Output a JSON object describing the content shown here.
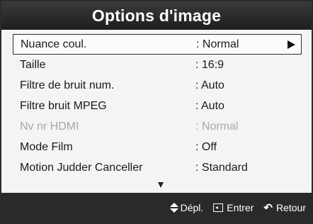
{
  "title": "Options d'image",
  "menu": {
    "items": [
      {
        "label": "Nuance coul.",
        "value": ": Normal",
        "state": "selected"
      },
      {
        "label": "Taille",
        "value": ": 16:9",
        "state": "normal"
      },
      {
        "label": "Filtre de bruit num.",
        "value": ": Auto",
        "state": "normal"
      },
      {
        "label": "Filtre bruit MPEG",
        "value": ": Auto",
        "state": "normal"
      },
      {
        "label": "Nv nr HDMI",
        "value": ": Normal",
        "state": "disabled"
      },
      {
        "label": "Mode Film",
        "value": ": Off",
        "state": "normal"
      },
      {
        "label": "Motion Judder Canceller",
        "value": ": Standard",
        "state": "normal"
      }
    ],
    "submenu_icon": "arrow-right-icon",
    "more_icon": "arrow-down-icon"
  },
  "footer": {
    "move_label": "Dépl.",
    "enter_label": "Entrer",
    "return_label": "Retour",
    "move_icon": "up-down-icon",
    "enter_icon": "enter-icon",
    "return_icon": "return-icon"
  },
  "colors": {
    "title_bar": "#2a2a2a",
    "panel_bg": "#f4f4f4",
    "disabled_text": "#a8a8a8"
  }
}
